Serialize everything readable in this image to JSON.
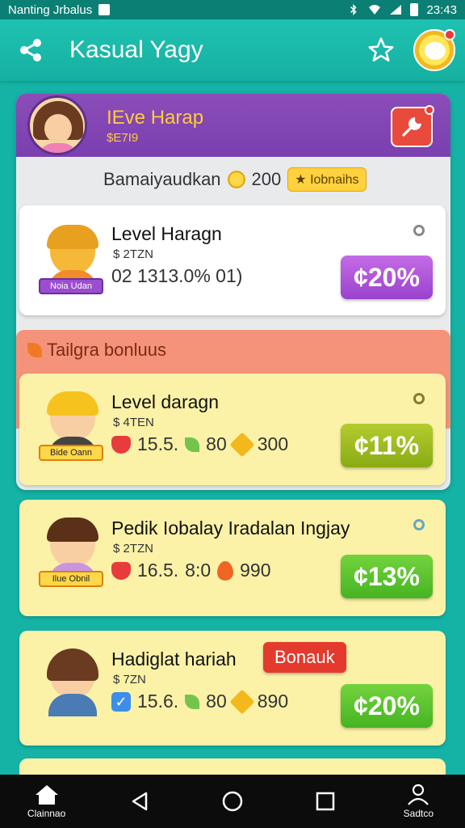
{
  "status_bar": {
    "carrier": "Nanting Jrbalus",
    "time": "23:43"
  },
  "app_bar": {
    "title": "Kasual Yagy"
  },
  "profile": {
    "name": "IEve Harap",
    "sub": "$E7I9",
    "balance_label": "Bamaiyaudkan",
    "balance_value": "200",
    "bonus_chip": "Iobnaihs"
  },
  "cards": [
    {
      "title": "Level Haragn",
      "code": "$ 2TZN",
      "stats": "02 1313.0% 01)",
      "percent": "¢20%",
      "tag": "Noia Udan",
      "color_percent": "#9a42cc"
    },
    {
      "title": "Level daragn",
      "code": "$ 4TEN",
      "stat1": "15.5.",
      "stat1b": "80",
      "stat2": "300",
      "percent": "¢11%",
      "tag": "Bide Oann"
    },
    {
      "title": "Pedik Iobalay Iradalan Ingjay",
      "code": "$ 2TZN",
      "stat1": "16.5.",
      "stat1b": "8:0",
      "stat2": "990",
      "percent": "¢13%",
      "tag": "Ilue Obnil"
    },
    {
      "title": "Hadiglat hariah",
      "code": "$ 7ZN",
      "badge": "Bonauk",
      "stat1": "15.6.",
      "stat1b": "80",
      "stat2": "890",
      "percent": "¢20%"
    }
  ],
  "section": {
    "label": "Tailgra bonluus"
  },
  "nav": {
    "home_label": "Clainnao",
    "profile_label": "Sadtco"
  },
  "colors": {
    "background": "#14b3a5",
    "profile_band": "#7a3fb0",
    "accent_yellow": "#ffcb3c"
  }
}
